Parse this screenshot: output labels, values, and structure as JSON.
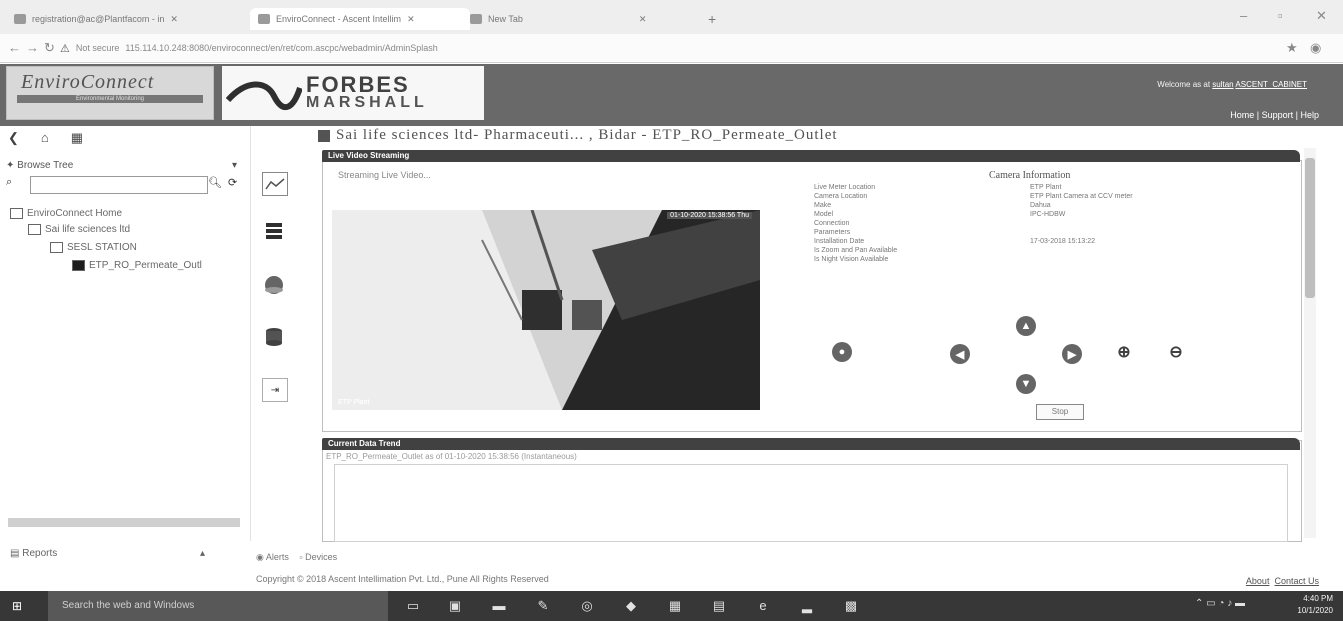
{
  "browser": {
    "tabs": [
      {
        "label": "registration@ac@Plantfacom - in"
      },
      {
        "label": "EnviroConnect - Ascent Intellim"
      },
      {
        "label": "New Tab"
      }
    ],
    "new_tab_icon": "plus-icon",
    "url_warning": "Not secure",
    "url": "115.114.10.248:8080/enviroconnect/en/ret/com.ascpc/webadmin/AdminSplash"
  },
  "header": {
    "logo_enviro": "EnviroConnect",
    "logo_enviro_sub": "Environmental Monitoring",
    "logo_forbes_1": "FORBES",
    "logo_forbes_2": "MARSHALL",
    "welcome_prefix": "Welcome as at",
    "welcome_user": "sultan",
    "welcome_extra": "ASCENT_CABINET",
    "links": [
      "Home",
      "Support",
      "Help"
    ]
  },
  "sidebar": {
    "browse_label": "Browse Tree",
    "search_placeholder": "",
    "tree": {
      "root": "EnviroConnect Home",
      "company": "Sai life sciences ltd",
      "station": "SESL STATION",
      "point": "ETP_RO_Permeate_Outl"
    }
  },
  "main": {
    "title": "Sai life sciences ltd- Pharmaceuti... , Bidar - ETP_RO_Permeate_Outlet",
    "live_header": "Live Video Streaming",
    "streaming_text": "Streaming Live Video...",
    "video_timestamp": "01-10-2020 15:38:56 Thu",
    "video_label": "ETP Plant",
    "camera_info": {
      "header": "Camera Information",
      "rows": [
        {
          "k": "Live Meter Location",
          "v": "ETP Plant"
        },
        {
          "k": "Camera Location",
          "v": "ETP Plant Camera at CCV meter"
        },
        {
          "k": "Make",
          "v": "Dahua"
        },
        {
          "k": "Model",
          "v": "IPC-HDBW"
        },
        {
          "k": "Connection",
          "v": ""
        },
        {
          "k": "Parameters",
          "v": ""
        },
        {
          "k": "Installation Date",
          "v": "17-03-2018 15:13:22"
        },
        {
          "k": "Is Zoom and Pan Available",
          "v": ""
        },
        {
          "k": "Is Night Vision Available",
          "v": ""
        }
      ]
    },
    "stop_label": "Stop",
    "data_header": "Current Data Trend",
    "data_sub": "ETP_RO_Permeate_Outlet as of 01-10-2020 15:38:56 (Instantaneous)"
  },
  "bottom": {
    "reports": "Reports",
    "alerts": "Alerts",
    "devices": "Devices",
    "copyright": "Copyright © 2018 Ascent Intellimation Pvt. Ltd., Pune All Rights Reserved",
    "about": "About",
    "contact": "Contact Us"
  },
  "taskbar": {
    "search": "Search the web and Windows",
    "time": "4:40 PM",
    "date": "10/1/2020"
  }
}
